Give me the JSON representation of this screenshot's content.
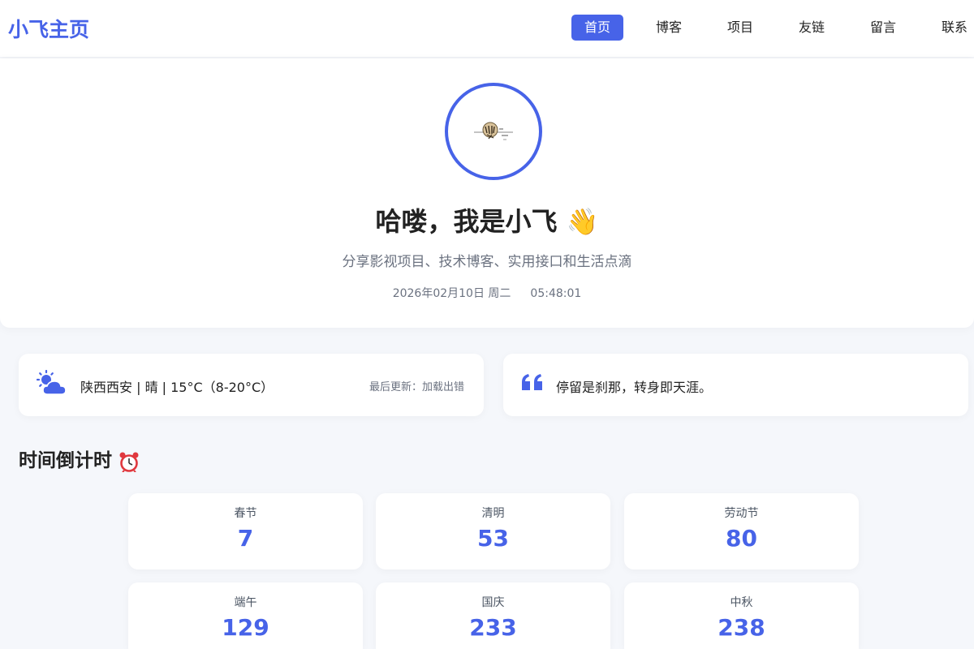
{
  "header": {
    "logo": "小飞主页",
    "nav": [
      {
        "label": "首页",
        "active": true
      },
      {
        "label": "博客",
        "active": false
      },
      {
        "label": "项目",
        "active": false
      },
      {
        "label": "友链",
        "active": false
      },
      {
        "label": "留言",
        "active": false
      },
      {
        "label": "联系",
        "active": false
      }
    ]
  },
  "hero": {
    "title": "哈喽，我是小飞 👋",
    "subtitle": "分享影视项目、技术博客、实用接口和生活点滴",
    "date": "2026年02月10日 周二",
    "time": "05:48:01"
  },
  "weather": {
    "icon": "cloud-sun-icon",
    "text": "陕西西安 | 晴 | 15°C（8-20°C）",
    "update": "最后更新：加载出错"
  },
  "quote": {
    "icon": "quote-icon",
    "text": "停留是刹那，转身即天涯。"
  },
  "countdown": {
    "title": "时间倒计时",
    "icon": "alarm-clock-icon",
    "items": [
      {
        "label": "春节",
        "days": "7"
      },
      {
        "label": "清明",
        "days": "53"
      },
      {
        "label": "劳动节",
        "days": "80"
      },
      {
        "label": "端午",
        "days": "129"
      },
      {
        "label": "国庆",
        "days": "233"
      },
      {
        "label": "中秋",
        "days": "238"
      }
    ]
  },
  "colors": {
    "accent": "#4763e8",
    "background": "#f5f7fb"
  }
}
